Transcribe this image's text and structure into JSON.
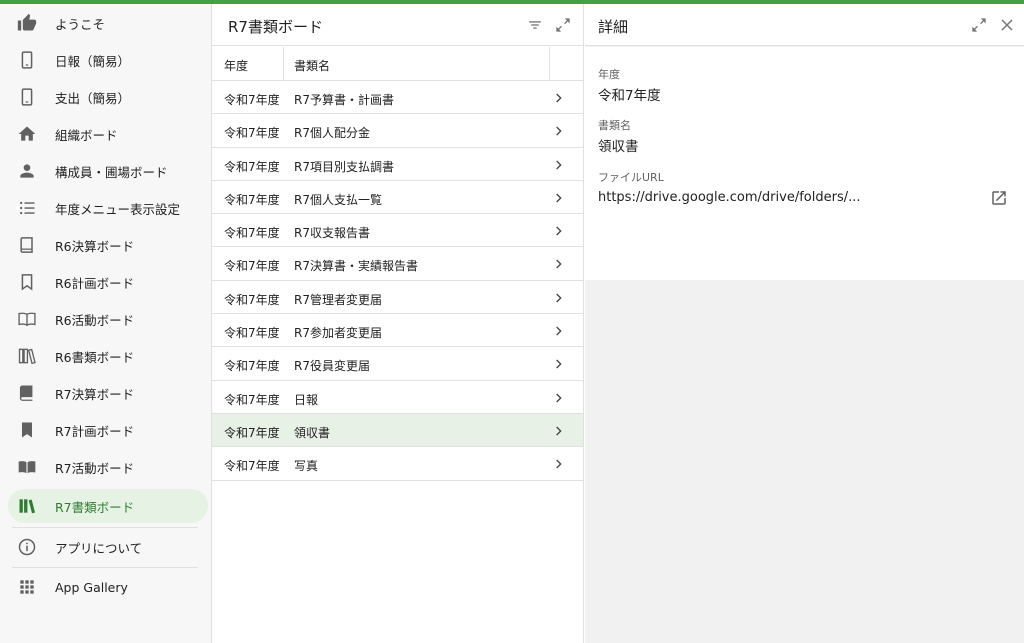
{
  "sidebar": {
    "items": [
      {
        "label": "ようこそ",
        "icon": "thumbs-up-icon"
      },
      {
        "label": "日報（簡易）",
        "icon": "phone-icon"
      },
      {
        "label": "支出（簡易）",
        "icon": "phone-icon"
      },
      {
        "label": "組織ボード",
        "icon": "home-icon"
      },
      {
        "label": "構成員・圃場ボード",
        "icon": "person-icon"
      },
      {
        "label": "年度メニュー表示設定",
        "icon": "list-icon"
      },
      {
        "label": "R6決算ボード",
        "icon": "book-outline-icon"
      },
      {
        "label": "R6計画ボード",
        "icon": "bookmark-outline-icon"
      },
      {
        "label": "R6活動ボード",
        "icon": "open-book-outline-icon"
      },
      {
        "label": "R6書類ボード",
        "icon": "library-outline-icon"
      },
      {
        "label": "R7決算ボード",
        "icon": "book-filled-icon"
      },
      {
        "label": "R7計画ボード",
        "icon": "bookmark-filled-icon"
      },
      {
        "label": "R7活動ボード",
        "icon": "open-book-filled-icon"
      },
      {
        "label": "R7書類ボード",
        "icon": "library-filled-icon"
      }
    ],
    "footer": [
      {
        "label": "アプリについて",
        "icon": "info-icon"
      },
      {
        "label": "App Gallery",
        "icon": "grid-icon"
      }
    ]
  },
  "list_panel": {
    "title": "R7書類ボード",
    "columns": [
      "年度",
      "書類名"
    ],
    "rows": [
      [
        "令和7年度",
        "R7予算書・計画書"
      ],
      [
        "令和7年度",
        "R7個人配分金"
      ],
      [
        "令和7年度",
        "R7項目別支払調書"
      ],
      [
        "令和7年度",
        "R7個人支払一覧"
      ],
      [
        "令和7年度",
        "R7収支報告書"
      ],
      [
        "令和7年度",
        "R7決算書・実績報告書"
      ],
      [
        "令和7年度",
        "R7管理者変更届"
      ],
      [
        "令和7年度",
        "R7参加者変更届"
      ],
      [
        "令和7年度",
        "R7役員変更届"
      ],
      [
        "令和7年度",
        "日報"
      ],
      [
        "令和7年度",
        "領収書"
      ],
      [
        "令和7年度",
        "写真"
      ]
    ],
    "selected_row": 10
  },
  "detail": {
    "title": "詳細",
    "fields": [
      {
        "label": "年度",
        "value": "令和7年度"
      },
      {
        "label": "書類名",
        "value": "領収書"
      },
      {
        "label": "ファイルURL",
        "value": "https://drive.google.com/drive/folders/..."
      }
    ]
  },
  "colors": {
    "accent": "#43a047",
    "selected": "#e6f2e4",
    "icon": "#616161"
  }
}
